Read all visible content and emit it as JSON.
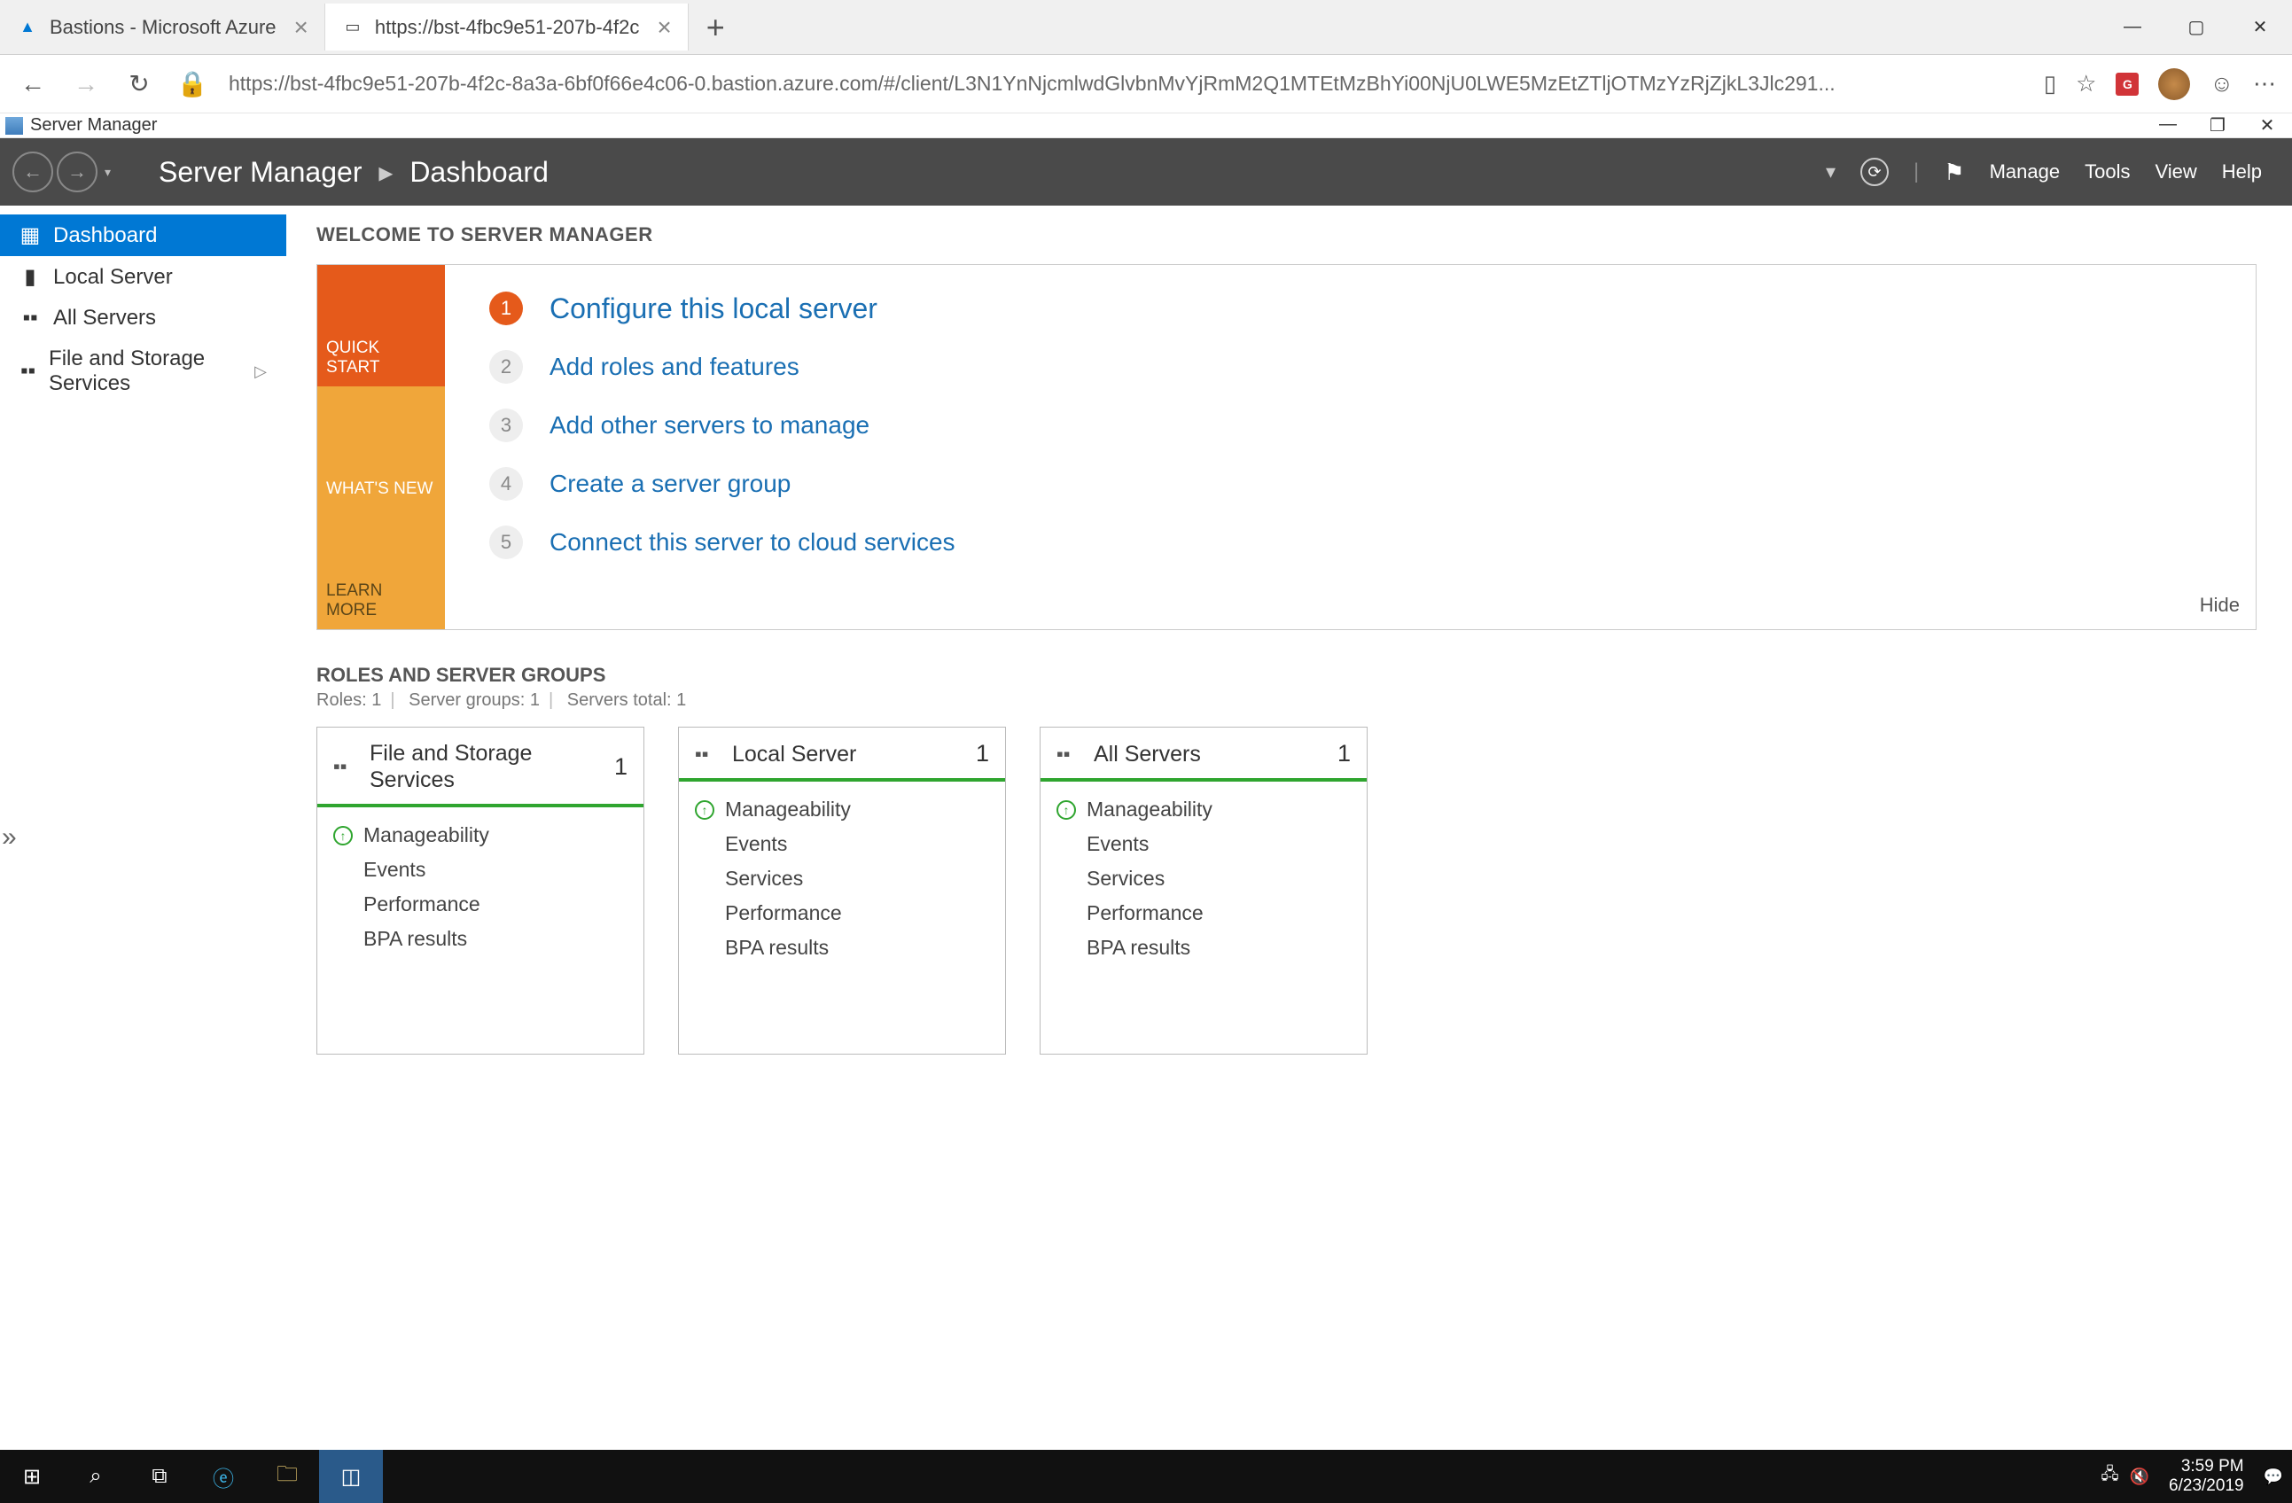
{
  "browser": {
    "tabs": [
      {
        "title": "Bastions - Microsoft Azure",
        "active": false,
        "favicon": "▲"
      },
      {
        "title": "https://bst-4fbc9e51-207b-4f2c",
        "active": true,
        "favicon": "—"
      }
    ],
    "url": "https://bst-4fbc9e51-207b-4f2c-8a3a-6bf0f66e4c06-0.bastion.azure.com/#/client/L3N1YnNjcmlwdGlvbnMvYjRmM2Q1MTEtMzBhYi00NjU0LWE5MzEtZTljOTMzYzRjZjkL3Jlc291...",
    "icons": [
      "reading-view",
      "favorite",
      "extension",
      "profile",
      "feedback",
      "more"
    ]
  },
  "serverManager": {
    "titlebar": "Server Manager",
    "breadcrumb": {
      "root": "Server Manager",
      "page": "Dashboard"
    },
    "menu": [
      "Manage",
      "Tools",
      "View",
      "Help"
    ],
    "sidebar": [
      {
        "label": "Dashboard",
        "icon": "▦",
        "selected": true
      },
      {
        "label": "Local Server",
        "icon": "▮"
      },
      {
        "label": "All Servers",
        "icon": "▪▪"
      },
      {
        "label": "File and Storage Services",
        "icon": "▪▪",
        "chevron": true
      }
    ],
    "welcome_title": "WELCOME TO SERVER MANAGER",
    "quick_tabs": {
      "qs": "QUICK START",
      "wn": "WHAT'S NEW",
      "lm": "LEARN MORE"
    },
    "steps": [
      {
        "n": "1",
        "text": "Configure this local server",
        "primary": true
      },
      {
        "n": "2",
        "text": "Add roles and features"
      },
      {
        "n": "3",
        "text": "Add other servers to manage"
      },
      {
        "n": "4",
        "text": "Create a server group"
      },
      {
        "n": "5",
        "text": "Connect this server to cloud services"
      }
    ],
    "hide": "Hide",
    "roles_title": "ROLES AND SERVER GROUPS",
    "roles_sub": {
      "roles": "Roles: 1",
      "groups": "Server groups: 1",
      "total": "Servers total: 1"
    },
    "tiles": [
      {
        "title": "File and Storage Services",
        "count": "1",
        "rows": [
          "Manageability",
          "Events",
          "Performance",
          "BPA results"
        ],
        "firstIcon": true
      },
      {
        "title": "Local Server",
        "count": "1",
        "rows": [
          "Manageability",
          "Events",
          "Services",
          "Performance",
          "BPA results"
        ],
        "firstIcon": true
      },
      {
        "title": "All Servers",
        "count": "1",
        "rows": [
          "Manageability",
          "Events",
          "Services",
          "Performance",
          "BPA results"
        ],
        "firstIcon": true
      }
    ]
  },
  "taskbar": {
    "time": "3:59 PM",
    "date": "6/23/2019"
  }
}
